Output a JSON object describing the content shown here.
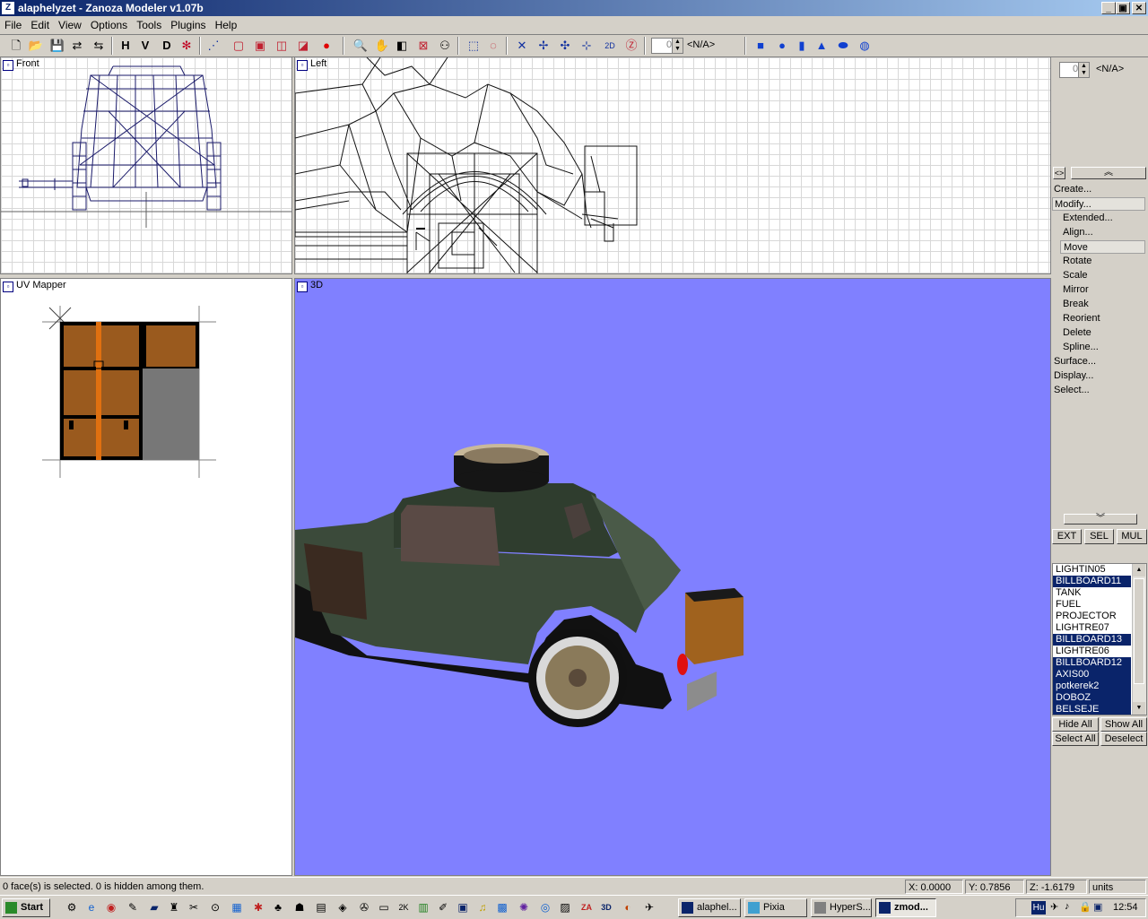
{
  "window": {
    "title": "alaphelyzet - Zanoza Modeler v1.07b"
  },
  "window_buttons": [
    "_",
    "▣",
    "✕"
  ],
  "menu": [
    "File",
    "Edit",
    "View",
    "Options",
    "Tools",
    "Plugins",
    "Help"
  ],
  "toolbar": {
    "letters": [
      "H",
      "V",
      "D"
    ],
    "spin_value": "0",
    "material_field": "<N/A>"
  },
  "viewports": {
    "front": "Front",
    "left": "Left",
    "uv": "UV Mapper",
    "view3d": "3D"
  },
  "right_panel": {
    "spin_value": "0",
    "field": "<N/A>",
    "menu": [
      "Create...",
      "Modify...",
      "Extended...",
      "Align...",
      "Move",
      "Rotate",
      "Scale",
      "Mirror",
      "Break",
      "Reorient",
      "Delete",
      "Spline...",
      "Surface...",
      "Display...",
      "Select..."
    ],
    "mode_buttons": [
      "EXT",
      "SEL",
      "MUL"
    ],
    "objects": [
      {
        "name": "LIGHTIN05",
        "selected": false
      },
      {
        "name": "BILLBOARD11",
        "selected": true
      },
      {
        "name": "TANK",
        "selected": false
      },
      {
        "name": "FUEL",
        "selected": false
      },
      {
        "name": "PROJECTOR",
        "selected": false
      },
      {
        "name": "LIGHTRE07",
        "selected": false
      },
      {
        "name": "BILLBOARD13",
        "selected": true
      },
      {
        "name": "LIGHTRE06",
        "selected": false
      },
      {
        "name": "BILLBOARD12",
        "selected": true
      },
      {
        "name": "AXIS00",
        "selected": true
      },
      {
        "name": "potkerek2",
        "selected": true
      },
      {
        "name": "DOBOZ",
        "selected": true
      },
      {
        "name": "BELSEJE",
        "selected": true
      }
    ],
    "list_buttons": [
      "Hide All",
      "Show All",
      "Select All",
      "Deselect"
    ]
  },
  "status": {
    "message": "0 face(s) is selected. 0 is hidden among them.",
    "x": "X: 0.0000",
    "y": "Y: 0.7856",
    "z": "Z: -1.6179",
    "units": "units"
  },
  "taskbar": {
    "start": "Start",
    "tasks": [
      "alaphel...",
      "Pixia",
      "HyperS...",
      "zmod..."
    ],
    "tray_lang": "Hu",
    "clock": "12:54"
  },
  "colors": {
    "viewport_3d": "#8080ff",
    "title_start": "#0a246a",
    "selection": "#0a246a"
  }
}
